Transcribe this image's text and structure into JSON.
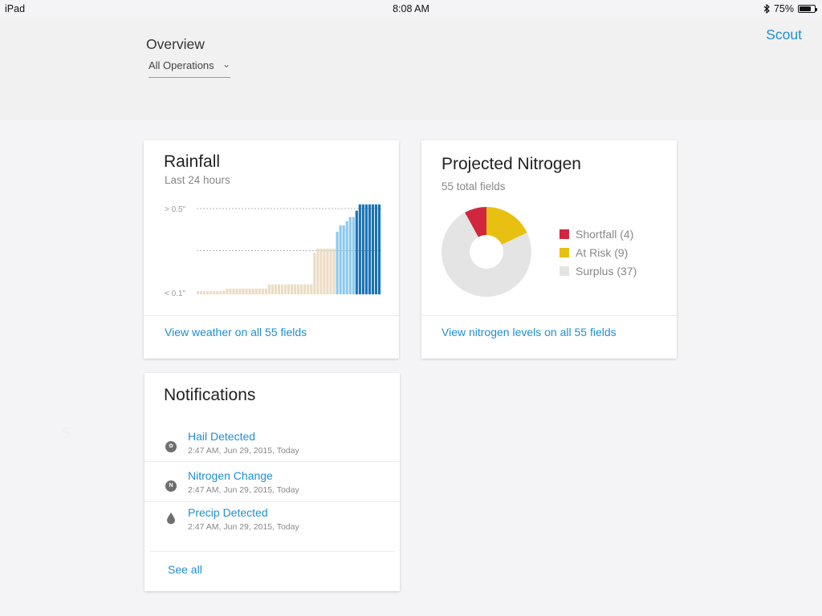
{
  "status_bar": {
    "device": "iPad",
    "time": "8:08 AM",
    "battery": "75%",
    "battery_level": 0.75
  },
  "header": {
    "title": "Overview",
    "operations_select": "All Operations",
    "scout_link": "Scout"
  },
  "side_marker": "5",
  "rainfall": {
    "title": "Rainfall",
    "subtitle": "Last 24 hours",
    "link": "View weather on all 55 fields",
    "chart_data": {
      "type": "bar",
      "title": "Rainfall",
      "subtitle": "Last 24 hours",
      "ytick_labels": [
        "> 0.5\"",
        "< 0.1\""
      ],
      "values": [
        0.1,
        0.1,
        0.1,
        0.1,
        0.1,
        0.1,
        0.1,
        0.1,
        0.11,
        0.12,
        0.12,
        0.12,
        0.12,
        0.12,
        0.12,
        0.12,
        0.12,
        0.12,
        0.12,
        0.12,
        0.12,
        0.12,
        0.14,
        0.14,
        0.14,
        0.14,
        0.14,
        0.14,
        0.14,
        0.14,
        0.14,
        0.14,
        0.14,
        0.14,
        0.14,
        0.14,
        0.29,
        0.31,
        0.31,
        0.31,
        0.31,
        0.31,
        0.31,
        0.39,
        0.42,
        0.42,
        0.44,
        0.46,
        0.46,
        0.49,
        0.52,
        0.52,
        0.52,
        0.52,
        0.52,
        0.52,
        0.52
      ],
      "bar_colors": [
        "#ecdcc4",
        "#c8e5f4",
        "#8cc9ee",
        "#1a73b8"
      ],
      "color_groups": [
        0,
        0,
        0,
        0,
        0,
        0,
        0,
        0,
        0,
        0,
        0,
        0,
        0,
        0,
        0,
        0,
        0,
        0,
        0,
        0,
        0,
        0,
        0,
        0,
        0,
        0,
        0,
        0,
        0,
        0,
        0,
        0,
        0,
        0,
        0,
        0,
        0,
        0,
        0,
        0,
        0,
        0,
        0,
        2,
        2,
        2,
        2,
        2,
        2,
        3,
        3,
        3,
        3,
        3,
        3,
        3,
        3
      ],
      "grid": "dotted"
    }
  },
  "nitrogen": {
    "title": "Projected Nitrogen",
    "subtitle": "55 total fields",
    "link": "View nitrogen levels on all 55 fields",
    "chart_data": {
      "type": "pie",
      "title": "Projected Nitrogen",
      "donut": true,
      "series": [
        {
          "name": "Shortfall (4)",
          "value": 4,
          "color": "#d0273f"
        },
        {
          "name": "At Risk (9)",
          "value": 9,
          "color": "#e8c011"
        },
        {
          "name": "Surplus (37)",
          "value": 37,
          "color": "#e4e4e4"
        }
      ],
      "legend_position": "right"
    }
  },
  "notifications": {
    "title": "Notifications",
    "items": [
      {
        "title": "Hail Detected",
        "time": "2:47 AM, Jun 29, 2015, Today",
        "icon": "hail-icon"
      },
      {
        "title": "Nitrogen Change",
        "time": "2:47 AM, Jun 29, 2015, Today",
        "icon": "nitrogen-icon"
      },
      {
        "title": "Precip Detected",
        "time": "2:47 AM, Jun 29, 2015, Today",
        "icon": "water-drop-icon"
      }
    ],
    "nitrogen_icon_glyph": "N",
    "see_all": "See all"
  }
}
